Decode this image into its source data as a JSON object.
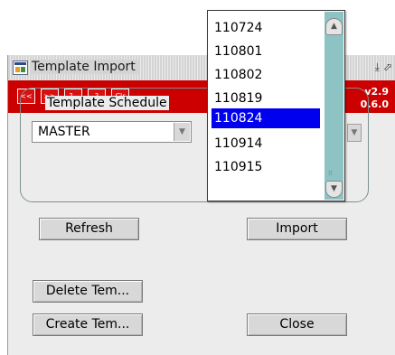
{
  "window": {
    "title": "Template Import",
    "version_line1": "v2.9",
    "version_line2": "0.6.0"
  },
  "toolbar": {
    "buttons": [
      {
        "label": "<<",
        "icon": "first-record-icon"
      },
      {
        "label": ">>",
        "icon": "last-record-icon"
      },
      {
        "label": "?..",
        "icon": "list-values-icon"
      },
      {
        "label": "?",
        "icon": "help-icon"
      },
      {
        "label": "Clr",
        "icon": "clear-icon"
      }
    ]
  },
  "template_schedule": {
    "label": "Template Schedule",
    "value": "MASTER"
  },
  "buttons": {
    "refresh": "Refresh",
    "import": "Import",
    "delete_template": "Delete Tem...",
    "create_template": "Create Tem...",
    "close": "Close"
  },
  "dropdown": {
    "items": [
      "110724",
      "110801",
      "110802",
      "110819",
      "110824",
      "110914",
      "110915"
    ],
    "selected_index": 4
  },
  "colors": {
    "toolbar": "#cc0000",
    "selection": "#0000ee",
    "scrollbar": "#8ec3c3"
  }
}
